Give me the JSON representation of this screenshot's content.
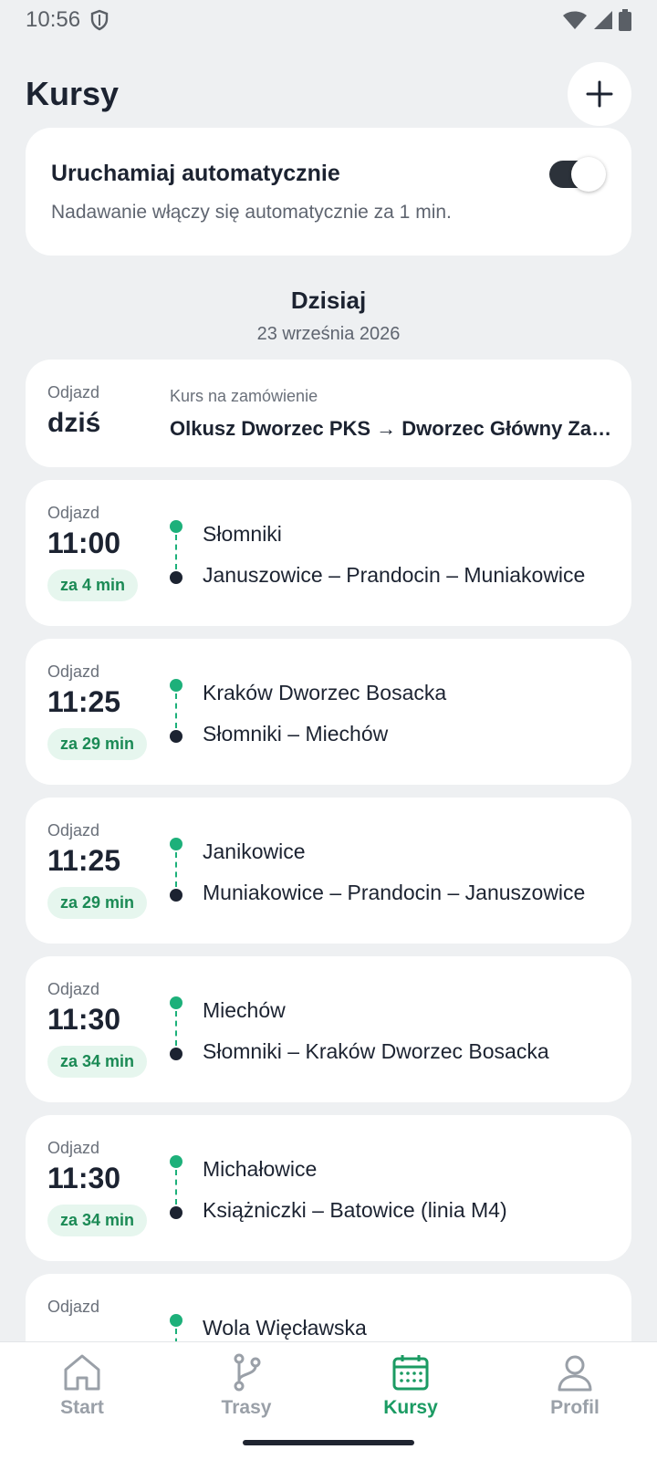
{
  "status": {
    "time": "10:56"
  },
  "header": {
    "title": "Kursy"
  },
  "auto": {
    "title": "Uruchamiaj automatycznie",
    "description": "Nadawanie włączy się automatycznie za 1 min.",
    "enabled": true
  },
  "day": {
    "title": "Dzisiaj",
    "date": "23 września 2026"
  },
  "ondemand": {
    "dep_label": "Odjazd",
    "when": "dziś",
    "type": "Kurs na zamówienie",
    "route": "Olkusz Dworzec PKS → Dworzec Główny Zachód"
  },
  "trips": [
    {
      "dep_label": "Odjazd",
      "time": "11:00",
      "eta": "za 4 min",
      "dest": "Słomniki",
      "via": "Januszowice – Prandocin – Muniakowice"
    },
    {
      "dep_label": "Odjazd",
      "time": "11:25",
      "eta": "za 29 min",
      "dest": "Kraków Dworzec Bosacka",
      "via": "Słomniki – Miechów"
    },
    {
      "dep_label": "Odjazd",
      "time": "11:25",
      "eta": "za 29 min",
      "dest": "Janikowice",
      "via": "Muniakowice – Prandocin – Januszowice"
    },
    {
      "dep_label": "Odjazd",
      "time": "11:30",
      "eta": "za 34 min",
      "dest": "Miechów",
      "via": "Słomniki – Kraków Dworzec Bosacka"
    },
    {
      "dep_label": "Odjazd",
      "time": "11:30",
      "eta": "za 34 min",
      "dest": "Michałowice",
      "via": "Książniczki – Batowice (linia M4)"
    },
    {
      "dep_label": "Odjazd",
      "time": "",
      "eta": "",
      "dest": "Wola Więcławska",
      "via": ""
    }
  ],
  "nav": {
    "start": "Start",
    "routes": "Trasy",
    "trips": "Kursy",
    "profile": "Profil"
  },
  "colors": {
    "accent": "#1b9b63",
    "dot_green": "#1db07a",
    "dark": "#1c2331"
  }
}
